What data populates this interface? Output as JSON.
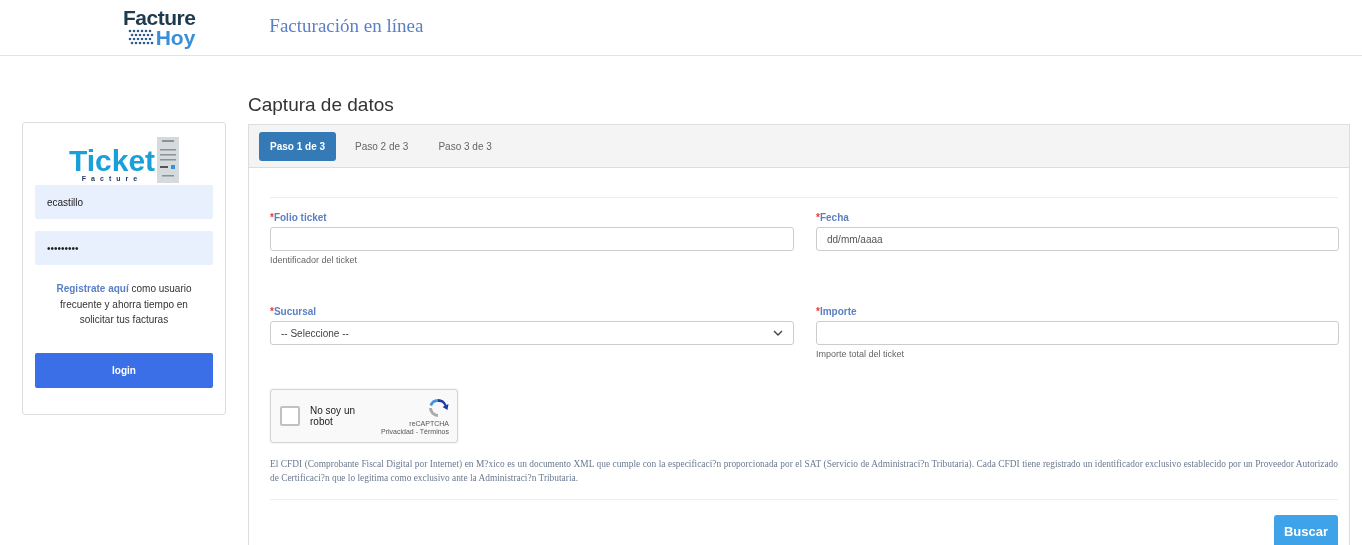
{
  "header": {
    "logo": {
      "line_1": "Facture",
      "line_2": "Hoy"
    },
    "title": "Facturación en línea"
  },
  "login_card": {
    "logo": {
      "word": "Ticket",
      "subword": "Facture"
    },
    "username": {
      "value": "ecastillo"
    },
    "password": {
      "value": "•••••••••"
    },
    "register": {
      "link": "Registrate aquí",
      "text": " como usuario frecuente y ahorra tiempo en solicitar tus facturas"
    },
    "button": "login"
  },
  "page_title": "Captura de datos",
  "tabs": [
    {
      "label": "Paso 1 de 3",
      "selected": true
    },
    {
      "label": "Paso 2 de 3",
      "selected": false
    },
    {
      "label": "Paso 3 de 3",
      "selected": false
    }
  ],
  "fields": [
    {
      "kind": "text",
      "required_mark": "*",
      "label": "Folio ticket",
      "help": "Identificador del ticket"
    },
    {
      "kind": "date",
      "required_mark": "*",
      "label": "Fecha",
      "placeholder": "dd/mm/aaaa"
    },
    {
      "kind": "select",
      "required_mark": "*",
      "label": "Sucursal",
      "value": "-- Seleccione --"
    },
    {
      "kind": "text",
      "required_mark": "*",
      "label": "Importe",
      "help": "Importe total del ticket"
    }
  ],
  "captcha": {
    "label": "No soy un robot",
    "checked": false,
    "brand": "reCAPTCHA",
    "links": "Privacidad - Términos"
  },
  "notice": "El CFDI (Comprobante Fiscal Digital por Internet) en M?xico es un documento XML que cumple con la especificaci?n proporcionada por el SAT (Servicio de Administraci?n Tributaria). Cada CFDI tiene registrado un identificador exclusivo establecido por un Proveedor Autorizado de Certificaci?n que lo legitima como exclusivo ante la Administraci?n Tributaria.",
  "search_button": "Buscar"
}
